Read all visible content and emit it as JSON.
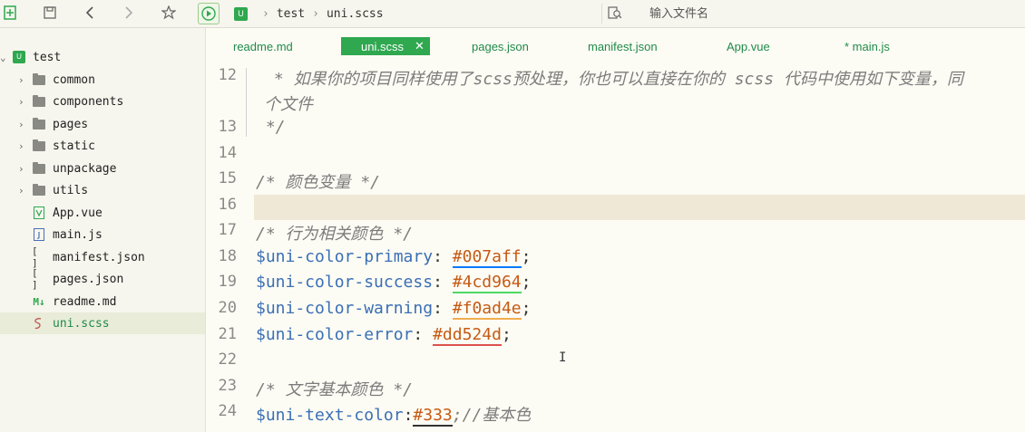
{
  "toolbar": {
    "icons": [
      "new-file-icon",
      "save-icon",
      "back-icon",
      "forward-icon",
      "star-icon",
      "run-icon"
    ]
  },
  "breadcrumb": {
    "root": "test",
    "file": "uni.scss",
    "badge": "U"
  },
  "search": {
    "placeholder": "输入文件名"
  },
  "sidebar": {
    "project": {
      "label": "test",
      "badge": "U"
    },
    "items": [
      {
        "label": "common",
        "type": "folder"
      },
      {
        "label": "components",
        "type": "folder"
      },
      {
        "label": "pages",
        "type": "folder"
      },
      {
        "label": "static",
        "type": "folder"
      },
      {
        "label": "unpackage",
        "type": "folder"
      },
      {
        "label": "utils",
        "type": "folder"
      },
      {
        "label": "App.vue",
        "type": "vue"
      },
      {
        "label": "main.js",
        "type": "js"
      },
      {
        "label": "manifest.json",
        "type": "json"
      },
      {
        "label": "pages.json",
        "type": "json"
      },
      {
        "label": "readme.md",
        "type": "md"
      },
      {
        "label": "uni.scss",
        "type": "scss",
        "active": true
      }
    ]
  },
  "tabs": [
    {
      "label": "readme.md"
    },
    {
      "label": "uni.scss",
      "active": true
    },
    {
      "label": "pages.json"
    },
    {
      "label": "manifest.json"
    },
    {
      "label": "App.vue"
    },
    {
      "label": "* main.js"
    }
  ],
  "colors": {
    "accent": "#2fa84f",
    "primary": "#007aff",
    "success": "#4cd964",
    "warning": "#f0ad4e",
    "error": "#dd524d",
    "text": "#333"
  },
  "editor": {
    "lines": [
      {
        "n": "12",
        "text": " * 如果你的项目同样使用了scss预处理，你也可以直接在你的 scss 代码中使用如下变量，同"
      },
      {
        "n": "",
        "text": "个文件"
      },
      {
        "n": "13",
        "text": " */"
      },
      {
        "n": "14",
        "text": ""
      },
      {
        "n": "15",
        "text": "/* 颜色变量 */"
      },
      {
        "n": "16",
        "text": ""
      },
      {
        "n": "17",
        "text": "/* 行为相关颜色 */"
      },
      {
        "n": "18",
        "var": "$uni-color-primary",
        "sep": ": ",
        "val": "#007aff",
        "end": ";"
      },
      {
        "n": "19",
        "var": "$uni-color-success",
        "sep": ": ",
        "val": "#4cd964",
        "end": ";"
      },
      {
        "n": "20",
        "var": "$uni-color-warning",
        "sep": ": ",
        "val": "#f0ad4e",
        "end": ";"
      },
      {
        "n": "21",
        "var": "$uni-color-error",
        "sep": ": ",
        "val": "#dd524d",
        "end": ";"
      },
      {
        "n": "22",
        "text": ""
      },
      {
        "n": "23",
        "text": "/* 文字基本颜色 */"
      },
      {
        "n": "24",
        "var": "$uni-text-color",
        "sep": ":",
        "val": "#333",
        "end": ";//基本色"
      }
    ]
  }
}
